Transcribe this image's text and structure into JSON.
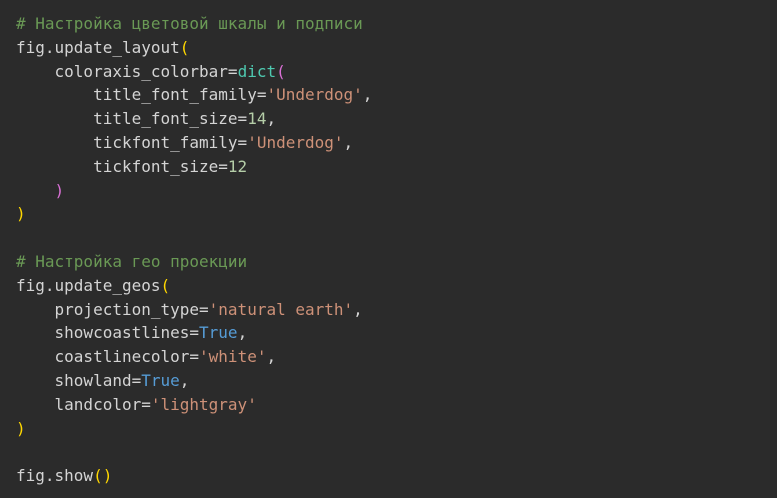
{
  "code_lines": [
    [
      {
        "t": "# Настройка цветовой шкалы и подписи",
        "k": "comment"
      }
    ],
    [
      {
        "t": "fig.update_layout",
        "k": "plain"
      },
      {
        "t": "(",
        "k": "paren1"
      }
    ],
    [
      {
        "t": "    coloraxis_colorbar=",
        "k": "plain"
      },
      {
        "t": "dict",
        "k": "builtin"
      },
      {
        "t": "(",
        "k": "paren2"
      }
    ],
    [
      {
        "t": "        title_font_family=",
        "k": "plain"
      },
      {
        "t": "'Underdog'",
        "k": "string"
      },
      {
        "t": ",",
        "k": "plain"
      }
    ],
    [
      {
        "t": "        title_font_size=",
        "k": "plain"
      },
      {
        "t": "14",
        "k": "number"
      },
      {
        "t": ",",
        "k": "plain"
      }
    ],
    [
      {
        "t": "        tickfont_family=",
        "k": "plain"
      },
      {
        "t": "'Underdog'",
        "k": "string"
      },
      {
        "t": ",",
        "k": "plain"
      }
    ],
    [
      {
        "t": "        tickfont_size=",
        "k": "plain"
      },
      {
        "t": "12",
        "k": "number"
      }
    ],
    [
      {
        "t": "    ",
        "k": "plain"
      },
      {
        "t": ")",
        "k": "paren2"
      }
    ],
    [
      {
        "t": ")",
        "k": "paren1"
      }
    ],
    [],
    [
      {
        "t": "# Настройка гео проекции",
        "k": "comment"
      }
    ],
    [
      {
        "t": "fig.update_geos",
        "k": "plain"
      },
      {
        "t": "(",
        "k": "paren1"
      }
    ],
    [
      {
        "t": "    projection_type=",
        "k": "plain"
      },
      {
        "t": "'natural earth'",
        "k": "string"
      },
      {
        "t": ",",
        "k": "plain"
      }
    ],
    [
      {
        "t": "    showcoastlines=",
        "k": "plain"
      },
      {
        "t": "True",
        "k": "keyword"
      },
      {
        "t": ",",
        "k": "plain"
      }
    ],
    [
      {
        "t": "    coastlinecolor=",
        "k": "plain"
      },
      {
        "t": "'white'",
        "k": "string"
      },
      {
        "t": ",",
        "k": "plain"
      }
    ],
    [
      {
        "t": "    showland=",
        "k": "plain"
      },
      {
        "t": "True",
        "k": "keyword"
      },
      {
        "t": ",",
        "k": "plain"
      }
    ],
    [
      {
        "t": "    landcolor=",
        "k": "plain"
      },
      {
        "t": "'lightgray'",
        "k": "string"
      }
    ],
    [
      {
        "t": ")",
        "k": "paren1"
      }
    ],
    [],
    [
      {
        "t": "fig.show",
        "k": "plain"
      },
      {
        "t": "()",
        "k": "paren1"
      }
    ]
  ],
  "colors": {
    "background": "#2b2b2b",
    "comment": "#6a9955",
    "plain": "#d4d4d4",
    "builtin": "#4ec9b0",
    "string": "#ce9178",
    "number": "#b5cea8",
    "keyword": "#569cd6",
    "paren1": "#ffd700",
    "paren2": "#da70d6"
  }
}
